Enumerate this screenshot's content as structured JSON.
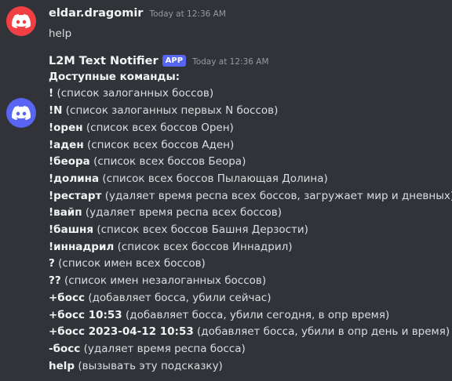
{
  "colors": {
    "background": "#313338",
    "user_avatar_bg": "#f23f43",
    "bot_avatar_bg": "#5865f2",
    "app_badge_bg": "#5865f2"
  },
  "messages": {
    "user": {
      "avatar_icon": "discord-logo-icon",
      "username": "eldar.dragomir",
      "timestamp": "Today at 12:36 AM",
      "text": "help"
    },
    "bot": {
      "avatar_icon": "discord-logo-icon",
      "username": "L2M Text Notifier",
      "badge": "APP",
      "timestamp": "Today at 12:36 AM",
      "heading": "Доступные команды:",
      "lines": [
        {
          "cmd": "!",
          "desc": " (список залоганных боссов)"
        },
        {
          "cmd": "!N",
          "desc": " (список залоганных первых N боссов)"
        },
        {
          "cmd": "!орен",
          "desc": " (список всех боссов Орен)"
        },
        {
          "cmd": "!аден",
          "desc": " (список всех боссов Аден)"
        },
        {
          "cmd": "!беора",
          "desc": " (список всех боссов Беора)"
        },
        {
          "cmd": "!долина",
          "desc": " (список всех боссов Пылающая Долина)"
        },
        {
          "cmd": "!рестарт",
          "desc": " (удаляет время респа всех боссов, загружает мир и дневных)"
        },
        {
          "cmd": "!вайп",
          "desc": " (удаляет время респа всех боссов)"
        },
        {
          "cmd": "!башня",
          "desc": " (список всех боссов Башня Дерзости)"
        },
        {
          "cmd": "!иннадрил",
          "desc": " (список всех боссов Иннадрил)"
        },
        {
          "cmd": "?",
          "desc": " (список имен всех боссов)"
        },
        {
          "cmd": "??",
          "desc": " (список имен незалоганных боссов)"
        },
        {
          "cmd": "+босс",
          "desc": " (добавляет босса, убили сейчас)"
        },
        {
          "cmd": "+босс 10:53",
          "desc": " (добавляет босса, убили сегодня, в опр время)"
        },
        {
          "cmd": "+босс 2023-04-12 10:53",
          "desc": " (добавляет босса, убили в опр день и время)"
        },
        {
          "cmd": "-босс",
          "desc": " (удаляет время респа босса)"
        },
        {
          "cmd": "help",
          "desc": " (вызывать эту подсказку)"
        }
      ]
    }
  }
}
